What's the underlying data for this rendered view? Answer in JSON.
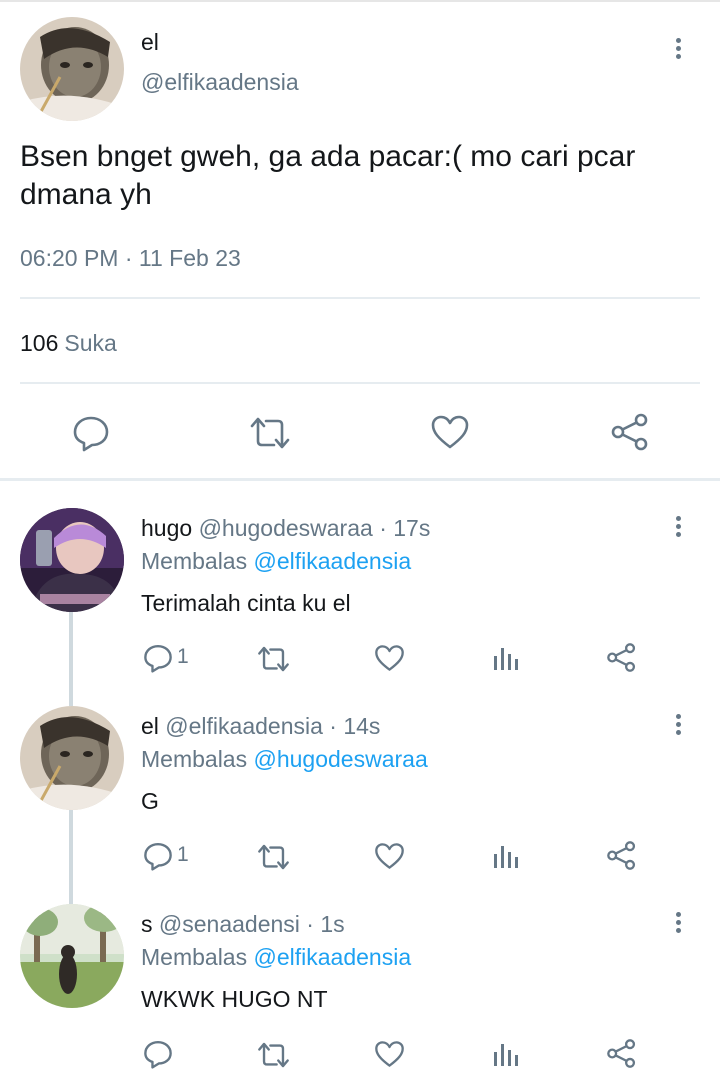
{
  "main_tweet": {
    "name": "el",
    "handle": "@elfikaadensia",
    "text": "Bsen bnget gweh, ga ada pacar:( mo cari pcar dmana yh",
    "time": "06:20 PM",
    "dot": "·",
    "date": "11 Feb 23",
    "likes_count": "106",
    "likes_label": "Suka"
  },
  "replies": [
    {
      "name": "hugo",
      "handle": "@hugodeswaraa",
      "time": "· 17s",
      "replying_label": "Membalas",
      "replying_to": "@elfikaadensia",
      "text": "Terimalah cinta ku el",
      "reply_count": "1"
    },
    {
      "name": "el",
      "handle": "@elfikaadensia",
      "time": "· 14s",
      "replying_label": "Membalas",
      "replying_to": "@hugodeswaraa",
      "text": "G",
      "reply_count": "1"
    },
    {
      "name": "s",
      "handle": "@senaadensi",
      "time": "· 1s",
      "replying_label": "Membalas",
      "replying_to": "@elfikaadensia",
      "text": "WKWK HUGO NT",
      "reply_count": ""
    }
  ],
  "colors": {
    "text_primary": "#14171a",
    "text_secondary": "#657786",
    "link": "#1da1f2",
    "separator": "#e6ecf0"
  },
  "icons": [
    "more-vertical-icon",
    "reply-icon",
    "retweet-icon",
    "like-icon",
    "share-icon",
    "analytics-icon"
  ]
}
